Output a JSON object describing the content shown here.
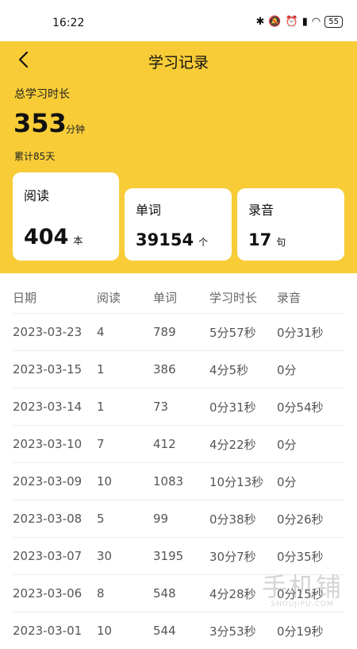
{
  "status": {
    "time": "16:22",
    "battery": "55"
  },
  "header": {
    "title": "学习记录"
  },
  "summary": {
    "total_label": "总学习时长",
    "total_value": "353",
    "total_unit": "分钟",
    "accumulated": "累计85天"
  },
  "cards": [
    {
      "label": "阅读",
      "value": "404",
      "unit": "本"
    },
    {
      "label": "单词",
      "value": "39154",
      "unit": "个"
    },
    {
      "label": "录音",
      "value": "17",
      "unit": "句"
    }
  ],
  "table": {
    "headers": [
      "日期",
      "阅读",
      "单词",
      "学习时长",
      "录音"
    ],
    "rows": [
      [
        "2023-03-23",
        "4",
        "789",
        "5分57秒",
        "0分31秒"
      ],
      [
        "2023-03-15",
        "1",
        "386",
        "4分5秒",
        "0分"
      ],
      [
        "2023-03-14",
        "1",
        "73",
        "0分31秒",
        "0分54秒"
      ],
      [
        "2023-03-10",
        "7",
        "412",
        "4分22秒",
        "0分"
      ],
      [
        "2023-03-09",
        "10",
        "1083",
        "10分13秒",
        "0分"
      ],
      [
        "2023-03-08",
        "5",
        "99",
        "0分38秒",
        "0分26秒"
      ],
      [
        "2023-03-07",
        "30",
        "3195",
        "30分7秒",
        "0分35秒"
      ],
      [
        "2023-03-06",
        "8",
        "548",
        "4分28秒",
        "0分15秒"
      ],
      [
        "2023-03-01",
        "10",
        "544",
        "3分53秒",
        "0分19秒"
      ]
    ]
  },
  "watermark": {
    "main": "手机铺",
    "sub": "SHOUJIPU.COM"
  },
  "colors": {
    "accent": "#f7cc37",
    "card": "#ffffff"
  }
}
